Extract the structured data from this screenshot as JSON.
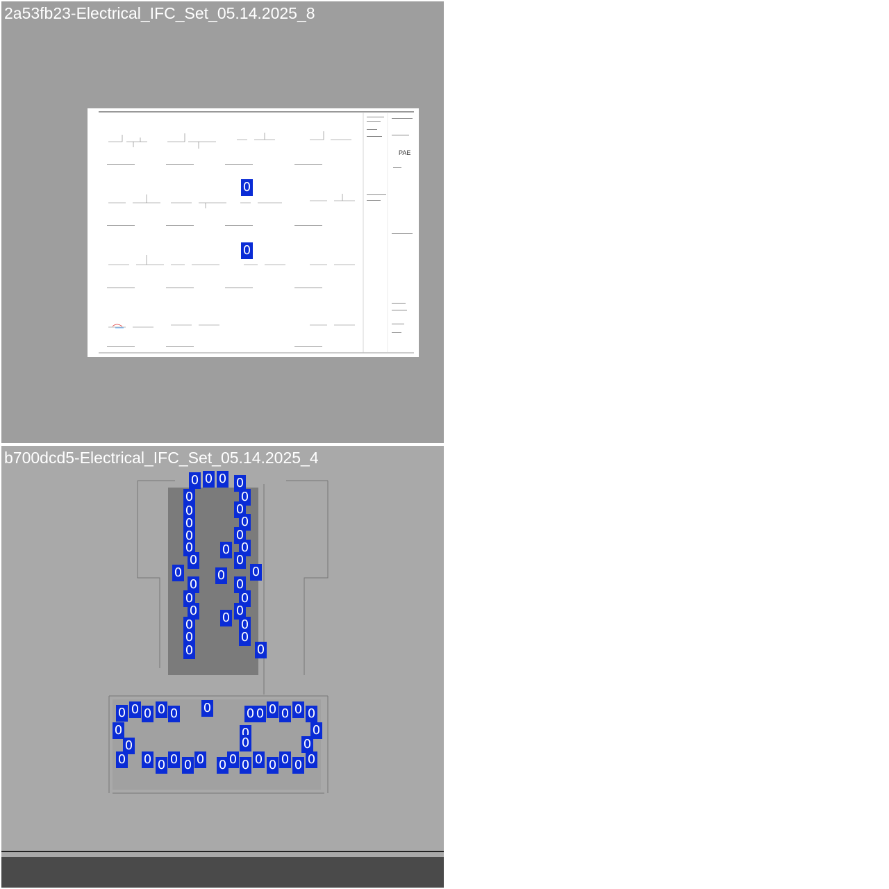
{
  "panels": [
    {
      "title": "2a53fb23-Electrical_IFC_Set_05.14.2025_8",
      "detection_label": "0",
      "logo_text": "PAE"
    },
    {
      "title": "b700dcd5-Electrical_IFC_Set_05.14.2025_4",
      "detection_label": "0"
    }
  ],
  "colors": {
    "detection_box": "#0a2cd6",
    "panel1_bg": "#9e9e9e",
    "panel2_bg": "#a9a9a9"
  }
}
